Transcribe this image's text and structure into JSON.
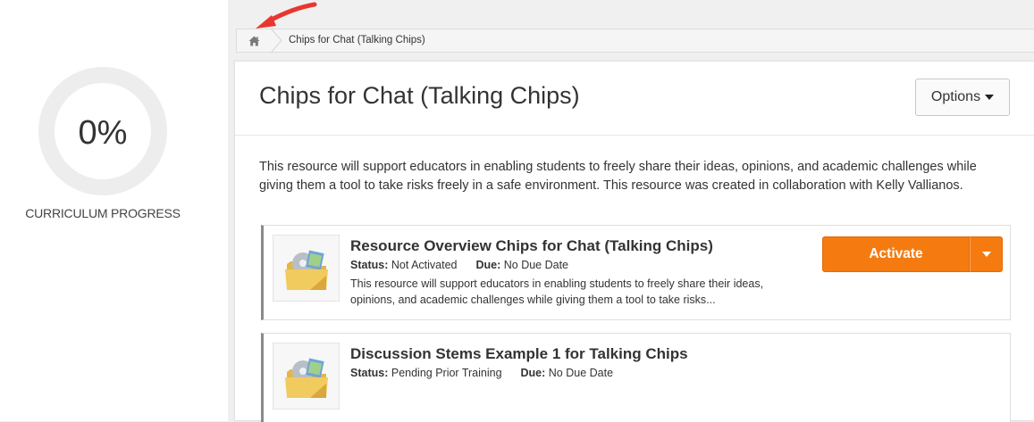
{
  "progress": {
    "value": "0%",
    "label": "CURRICULUM PROGRESS"
  },
  "breadcrumb": {
    "home_icon": "home-icon",
    "current": "Chips for Chat (Talking Chips)"
  },
  "annotation": {
    "arrow_color": "#e8372f"
  },
  "main": {
    "title": "Chips for Chat (Talking Chips)",
    "options_label": "Options",
    "description": "This resource will support educators in enabling students to freely share their ideas, opinions, and academic challenges while giving them a tool to take risks freely in a safe environment. This resource was created in collaboration with Kelly Vallianos."
  },
  "resources": [
    {
      "title": "Resource Overview Chips for Chat (Talking Chips)",
      "status_label": "Status:",
      "status_value": "Not Activated",
      "due_label": "Due:",
      "due_value": "No Due Date",
      "description": "This resource will support educators in enabling students to freely share their ideas, opinions, and academic challenges while giving them a tool to take risks...",
      "action_label": "Activate",
      "thumb_icon": "folder-disc-icon"
    },
    {
      "title": "Discussion Stems Example 1 for Talking Chips",
      "status_label": "Status:",
      "status_value": "Pending Prior Training",
      "due_label": "Due:",
      "due_value": "No Due Date",
      "thumb_icon": "folder-disc-icon"
    }
  ],
  "colors": {
    "accent_orange": "#f57b11",
    "ring_gray": "#ededed"
  }
}
